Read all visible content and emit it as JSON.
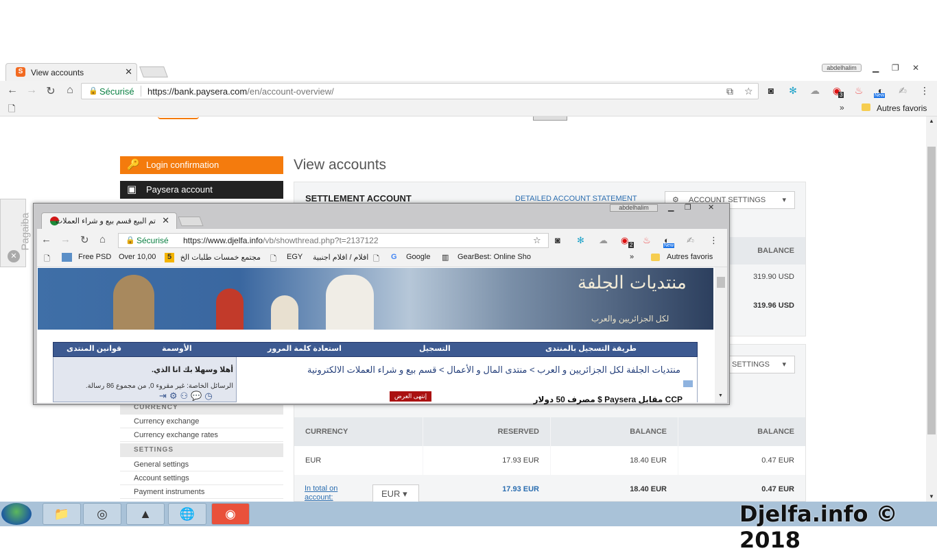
{
  "browser": {
    "tab_title": "View accounts",
    "profile": "abdelhalim",
    "secure_label": "Sécurisé",
    "url_host": "https://bank.paysera.com",
    "url_path": "/en/account-overview/",
    "bookmark_other": "Autres favoris",
    "ext_badge_count": "3",
    "ext_badge_new": "New"
  },
  "sidebar": {
    "login_confirmation": "Login confirmation",
    "paysera_account": "Paysera account",
    "currency_heading": "CURRENCY",
    "currency_links": [
      "Currency exchange",
      "Currency exchange rates"
    ],
    "settings_heading": "SETTINGS",
    "settings_links": [
      "General settings",
      "Account settings",
      "Payment instruments"
    ]
  },
  "main": {
    "page_title": "View accounts",
    "settlement_title": "SETTLEMENT ACCOUNT",
    "detailed_statement": "DETAILED ACCOUNT STATEMENT",
    "account_settings": "ACCOUNT SETTINGS",
    "balance_header": "BALANCE",
    "balance_row1": "319.90 USD",
    "balance_row2": "319.96 USD",
    "settings_button2": "SETTINGS",
    "table_headers": [
      "CURRENCY",
      "RESERVED",
      "BALANCE",
      "BALANCE"
    ],
    "eur_row": {
      "currency": "EUR",
      "reserved": "17.93 EUR",
      "balance": "18.40 EUR",
      "available": "0.47 EUR"
    },
    "total_link_line1": "In total on",
    "total_link_line2": "account:",
    "total_select": "EUR",
    "total_row": {
      "reserved": "17.93 EUR",
      "balance": "18.40 EUR",
      "available": "0.47 EUR"
    }
  },
  "pagaiba": {
    "label": "Pagaiba"
  },
  "popup": {
    "tab_title": "تم البيع قسم بيع و شراء العملات",
    "profile": "abdelhalim",
    "secure_label": "Sécurisé",
    "url_host": "https://www.djelfa.info",
    "url_path": "/vb/showthread.php?t=2137122",
    "ext_badge_count": "2",
    "ext_badge_new": "New",
    "bookmarks": [
      "Free PSD",
      "Over 10,00",
      "5",
      "مجتمع خمسات  طلبات الخ",
      "EGY",
      "افلام / افلام اجنبية",
      "Google",
      "GearBest: Online Sho"
    ],
    "bookmark_other": "Autres favoris",
    "logo_title": "منتديات الجلفة",
    "logo_sub": "لكل الجزائريين والعرب",
    "nav": [
      "طريقة التسجيل بالمنتدى",
      "التسجيل",
      "استعادة كلمة المرور",
      "الأوسمة",
      "قوانين المنتدى"
    ],
    "welcome": "أهلا وسهلا بك انا الذي.",
    "messages": "الرسائل الخاصة: غير مقروء 0, من مجموع 86 رسالة.",
    "breadcrumb": "منتديات الجلفة لكل الجزائريين و العرب > منتدى المال و الأعمال > قسم بيع و شراء العملات الالكترونية",
    "closed_badge": "إنتهى العرض",
    "thread_title": "CCP مقابل Paysera $ مصرف 50 دولار"
  },
  "watermark": "Djelfa.info © 2018"
}
